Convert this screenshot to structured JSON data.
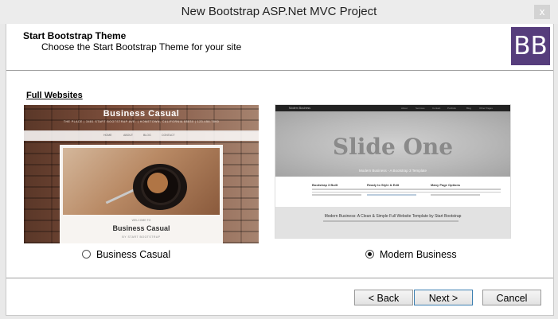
{
  "window": {
    "title": "New Bootstrap ASP.Net MVC Project",
    "close_glyph": "x"
  },
  "header": {
    "title": "Start Bootstrap Theme",
    "subtitle": "Choose the Start Bootstrap Theme for your  site",
    "logo_text": "BB",
    "logo_color": "#563d7c"
  },
  "section": {
    "label": "Full Websites"
  },
  "themes": [
    {
      "name": "Business Casual",
      "selected": false,
      "preview": {
        "site_title": "Business Casual",
        "tagline": "THE PLACE | 3481 START BOOTSTRAP AVE. | HOMETOWN, CALIFORNIA 88830 | 123.456.7890",
        "nav": [
          "HOME",
          "ABOUT",
          "BLOG",
          "CONTACT"
        ],
        "welcome": "WELCOME TO",
        "box_title": "Business Casual",
        "byline": "BY START BOOTSTRAP"
      }
    },
    {
      "name": "Modern Business",
      "selected": true,
      "preview": {
        "brand": "Modern Business",
        "nav": [
          "About",
          "Services",
          "Contact",
          "Portfolio",
          "Blog",
          "Other Pages"
        ],
        "slide_title": "Slide One",
        "slide_caption": "Modern Business - A Bootstrap 3 Template",
        "columns": [
          "Bootstrap 3 Built",
          "Ready to Style & Edit",
          "Many Page Options"
        ],
        "strip_text": "Modern Business: A Clean & Simple Full Website Template by Start Bootstrap"
      }
    }
  ],
  "buttons": {
    "back": "< Back",
    "next": "Next >",
    "cancel": "Cancel"
  }
}
